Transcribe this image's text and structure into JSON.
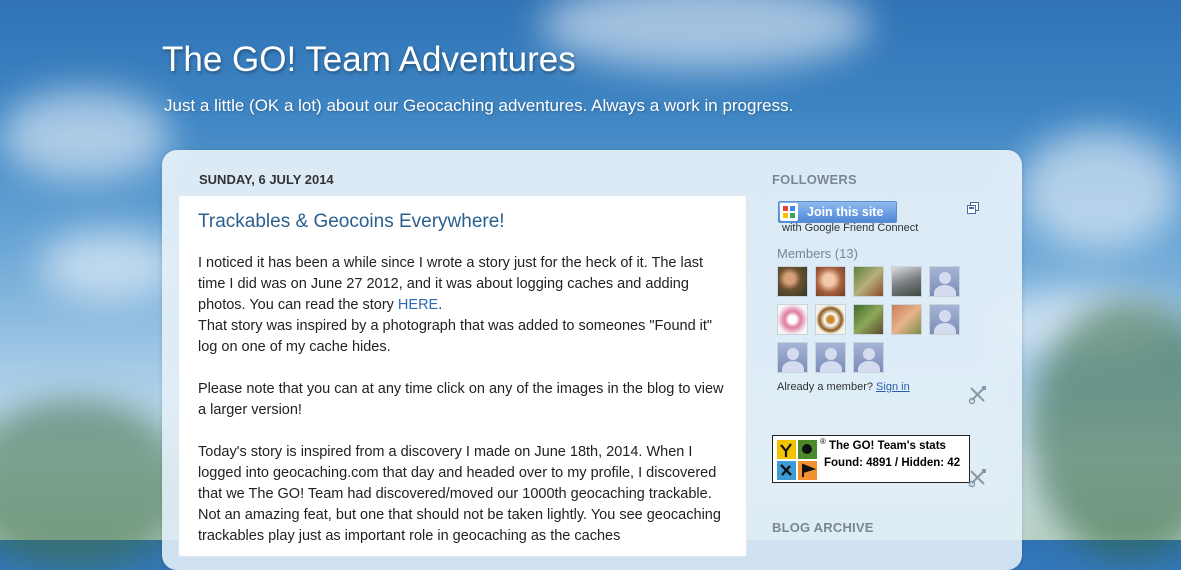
{
  "blog": {
    "title": "The GO! Team Adventures",
    "description": "Just a little (OK a lot) about our Geocaching adventures. Always a work in progress."
  },
  "post": {
    "date": "SUNDAY, 6 JULY 2014",
    "title": "Trackables & Geocoins Everywhere!",
    "p1_a": "I noticed it has been a while since I wrote a story just for the heck of it.  The last time I did was on June 27 2012, and it was about logging caches and adding photos.  You can read the story ",
    "p1_link": "HERE",
    "p1_b": ".",
    "p1_c": "That story was inspired by a photograph that was added to someones \"Found it\" log on one of my cache hides.",
    "p2": "Please note that you can at any time click on any of the images in the blog to view a larger version!",
    "p3": "Today's story is inspired from a discovery I made on June 18th, 2014.  When I logged into geocaching.com that day and headed over to my profile, I discovered that we The GO! Team had discovered/moved our 1000th geocaching trackable.  Not an amazing feat, but one that should not be taken lightly.  You see geocaching trackables play just as important role in geocaching as the caches"
  },
  "sidebar": {
    "followers_heading": "FOLLOWERS",
    "join_label": "Join this site",
    "gfc_caption": "with Google Friend Connect",
    "members_label": "Members (13)",
    "already_text": "Already a member? ",
    "sign_in_label": "Sign in",
    "archive_heading": "BLOG ARCHIVE",
    "stats_badge": {
      "registered_mark": "®",
      "title": "The GO! Team's stats",
      "stats": "Found: 4891 / Hidden: 42"
    }
  },
  "colors": {
    "post_title": "#2b5f8e",
    "link": "#2a6ab3",
    "sidebar_heading": "#7a8794"
  },
  "icons": [
    "google-g-icon",
    "popout-icon",
    "wrench-screwdriver-icon",
    "geocaching-logo-icon",
    "default-avatar-icon"
  ]
}
